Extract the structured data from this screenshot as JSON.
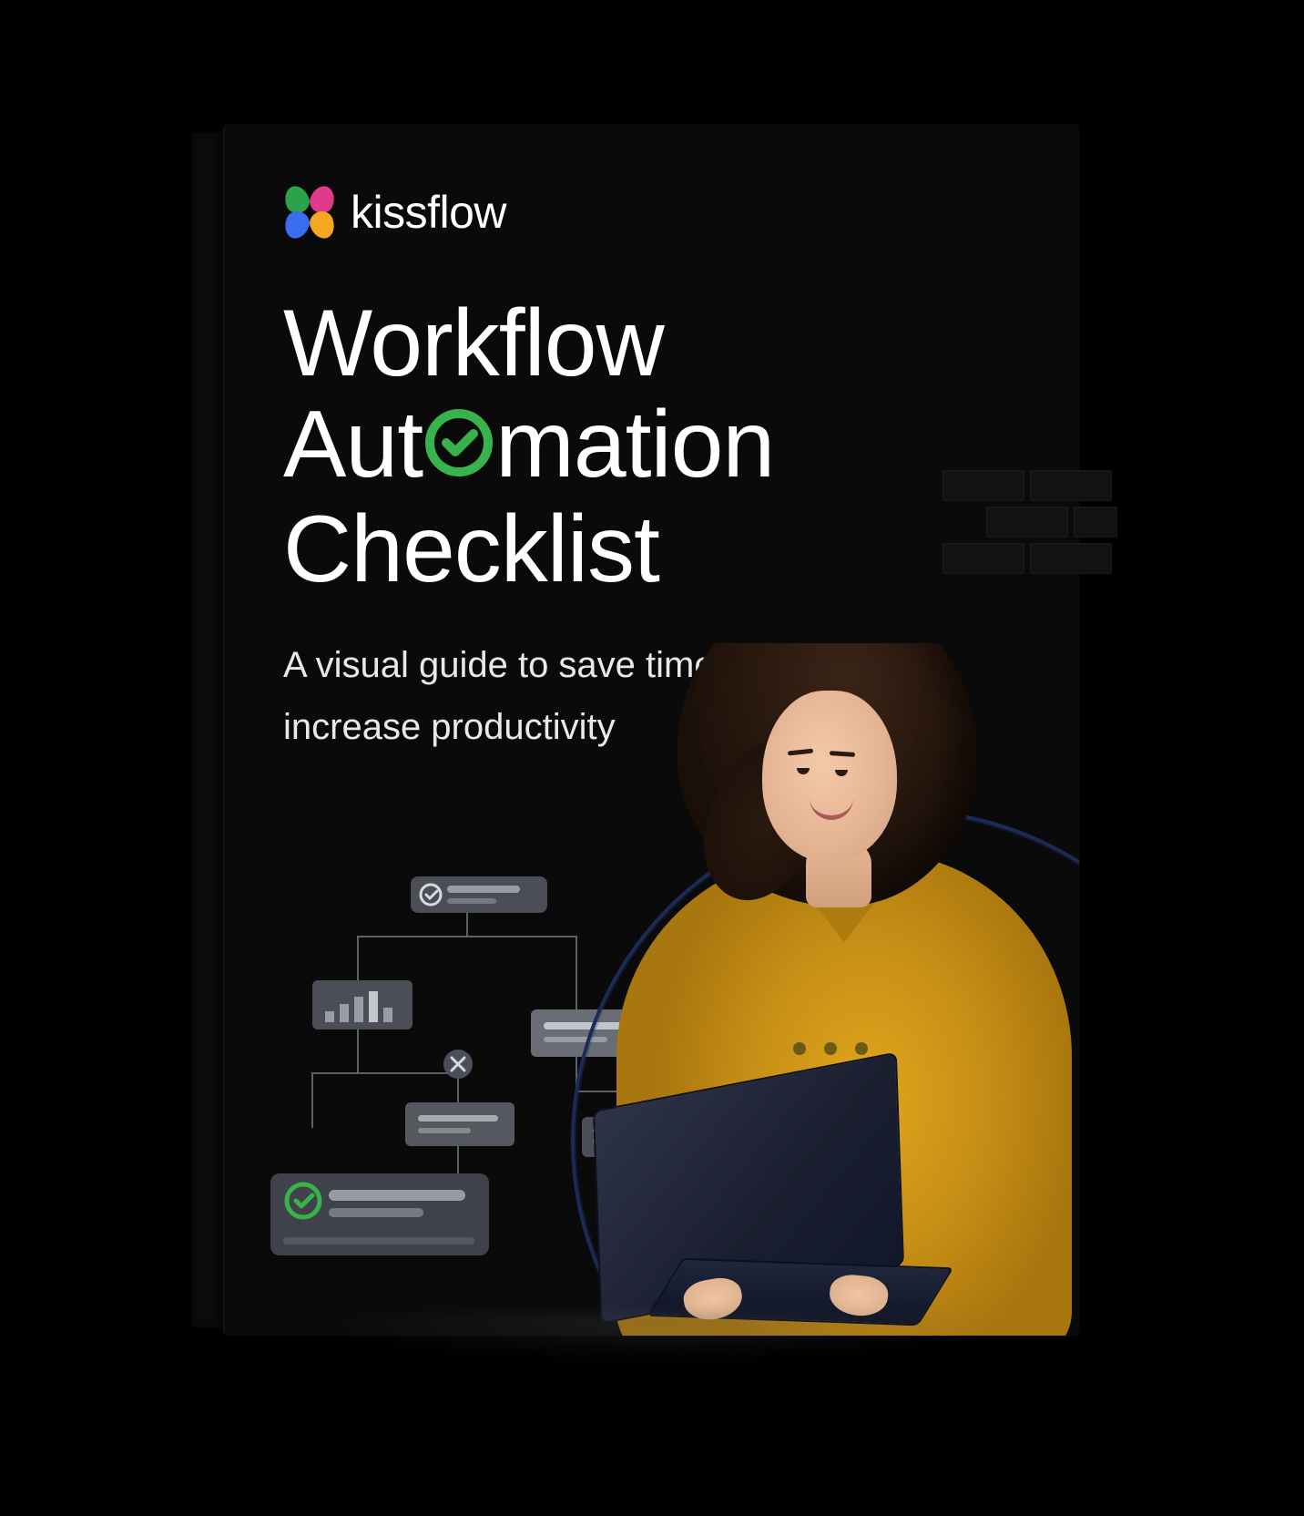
{
  "brand": {
    "name": "kissflow",
    "logo_colors": {
      "top_left": "#2aa34a",
      "top_right": "#e03a8c",
      "bottom_left": "#3a6df0",
      "bottom_right": "#f5a623"
    }
  },
  "cover": {
    "title_line1": "Workflow",
    "title_line2_before_o": "Aut",
    "title_line2_after_o": "mation",
    "title_line3": "Checklist",
    "subtitle": "A visual guide to save time and increase productivity",
    "accent_check_color": "#38b24a"
  },
  "palette": {
    "background": "#000000",
    "cover_bg": "#0a0a0a",
    "text_primary": "#ffffff",
    "text_secondary": "#e9e9ea",
    "shirt": "#e0a61c",
    "arc": "#1b2b55"
  },
  "illustration": {
    "subject": "woman-with-laptop",
    "diagram": "workflow-cards-connected"
  }
}
